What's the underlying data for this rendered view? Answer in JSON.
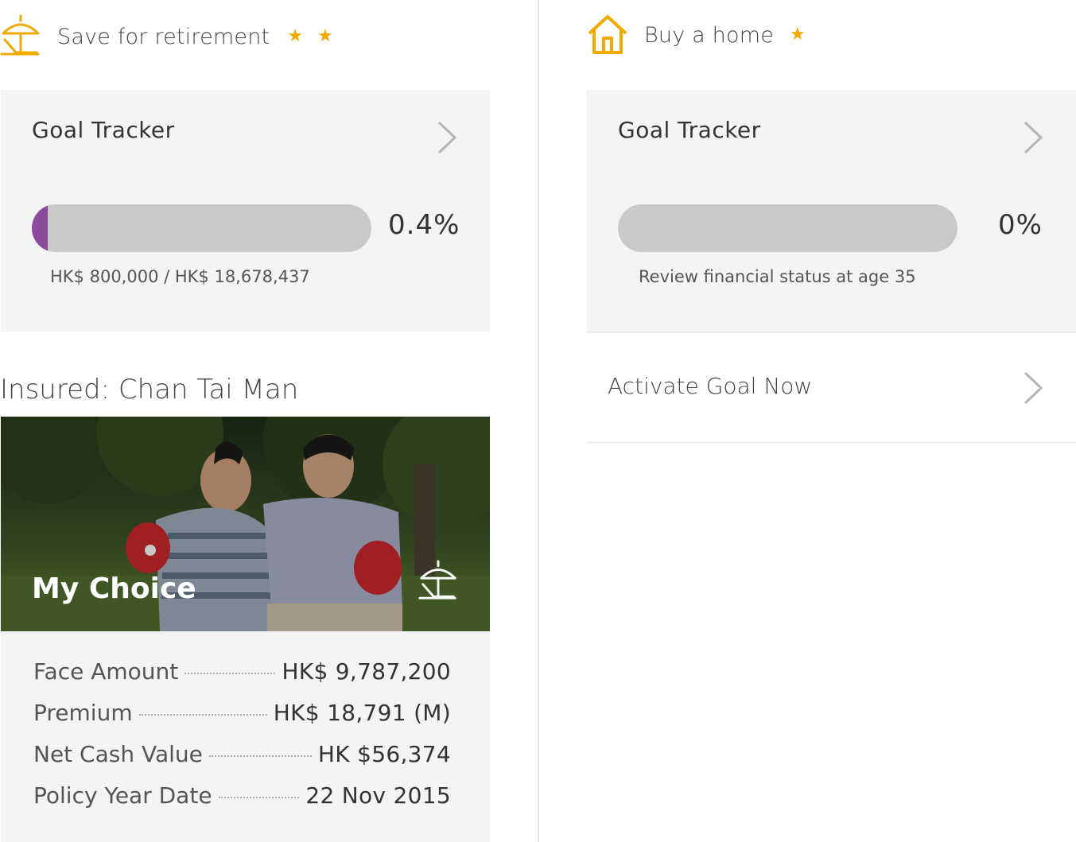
{
  "left_goal": {
    "title": "Save for retirement",
    "icon": "beach-umbrella-icon",
    "stars": 2,
    "tracker": {
      "title": "Goal Tracker",
      "progress_percent": 0.4,
      "percent_label": "0.4%",
      "amount_text": "HK$ 800,000 / HK$ 18,678,437"
    }
  },
  "right_goal": {
    "title": "Buy a home",
    "icon": "house-icon",
    "stars": 1,
    "tracker": {
      "title": "Goal Tracker",
      "progress_percent": 0,
      "percent_label": "0%",
      "review_text": "Review financial status at age 35"
    },
    "activate_label": "Activate Goal Now"
  },
  "insured": {
    "label": "Insured: Chan Tai Man",
    "plan_name": "My Choice",
    "plan_icon": "beach-umbrella-icon",
    "details": [
      {
        "label": "Face Amount",
        "value": "HK$ 9,787,200"
      },
      {
        "label": "Premium",
        "value": "HK$ 18,791 (M)"
      },
      {
        "label": "Net Cash Value",
        "value": "HK $56,374"
      },
      {
        "label": "Policy Year Date",
        "value": "22 Nov 2015"
      }
    ]
  },
  "colors": {
    "accent": "#f2a900",
    "progress_fill": "#8b4a9a",
    "track": "#c9cac8",
    "card_bg": "#f4f4f4"
  }
}
